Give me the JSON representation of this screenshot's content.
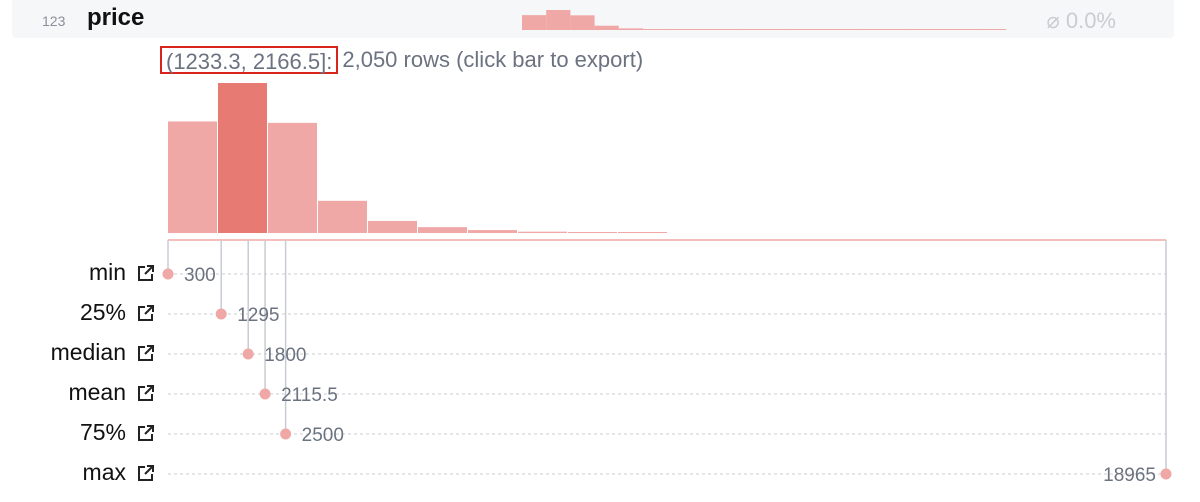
{
  "header": {
    "type_badge": "123",
    "column_name": "price",
    "null_text": "⌀ 0.0%"
  },
  "tooltip": {
    "range": "(1233.3, 2166.5]:",
    "text": "2,050 rows (click bar to export)"
  },
  "chart_data": {
    "type": "bar",
    "values": [
      1525,
      2050,
      1505,
      440,
      165,
      80,
      40,
      18,
      12,
      6
    ],
    "highlighted_index": 1,
    "x_min": 300,
    "x_max": 18965,
    "ylim": [
      0,
      2050
    ]
  },
  "mini_hist": {
    "values": [
      1525,
      2050,
      1505,
      440,
      165,
      80,
      40,
      18,
      12,
      6,
      4,
      3,
      2,
      2,
      1,
      1,
      1,
      1,
      1,
      1
    ]
  },
  "stats": [
    {
      "label": "min",
      "value": 300,
      "value_text": "300"
    },
    {
      "label": "25%",
      "value": 1295,
      "value_text": "1295"
    },
    {
      "label": "median",
      "value": 1800,
      "value_text": "1800"
    },
    {
      "label": "mean",
      "value": 2115.5,
      "value_text": "2115.5"
    },
    {
      "label": "75%",
      "value": 2500,
      "value_text": "2500"
    },
    {
      "label": "max",
      "value": 18965,
      "value_text": "18965"
    }
  ],
  "colors": {
    "bar": "#f0a8a7",
    "bar_highlight": "#e87a74",
    "dot": "#f0a8a7",
    "axis": "#f0a8a7",
    "guide": "#c8ccd2",
    "dash": "#c8ccd2"
  },
  "icons": {
    "export": "external-link-icon"
  }
}
